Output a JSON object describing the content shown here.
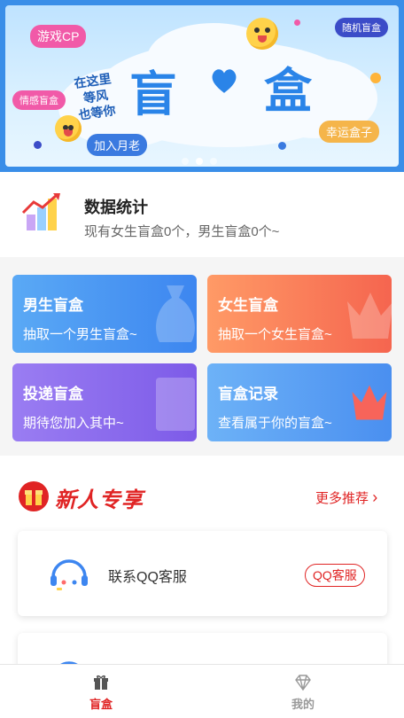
{
  "banner": {
    "title_left": "盲",
    "title_right": "盒",
    "tags": {
      "game_cp": "游戏CP",
      "random_box": "随机盲盒",
      "emotion_box": "情感盲盒",
      "join_moon": "加入月老",
      "lucky_box": "幸运盒子"
    },
    "handwrite_lines": [
      "在这里",
      "等风",
      "也等你"
    ],
    "slide_count": 3,
    "active_slide": 2
  },
  "stats": {
    "title": "数据统计",
    "subtitle": "现有女生盲盒0个，男生盲盒0个~"
  },
  "cards": [
    {
      "title": "男生盲盒",
      "subtitle": "抽取一个男生盲盒~",
      "icon": "money-bag-icon",
      "color_from": "#5aa9f5",
      "color_to": "#3d86f0"
    },
    {
      "title": "女生盲盒",
      "subtitle": "抽取一个女生盲盒~",
      "icon": "crown-icon",
      "color_from": "#ff9a66",
      "color_to": "#f5654f"
    },
    {
      "title": "投递盲盒",
      "subtitle": "期待您加入其中~",
      "icon": "bar-chart-icon",
      "color_from": "#9a7df2",
      "color_to": "#7d5be8"
    },
    {
      "title": "盲盒记录",
      "subtitle": "查看属于你的盲盒~",
      "icon": "crown-icon",
      "color_from": "#6db2f7",
      "color_to": "#4a8ff0"
    }
  ],
  "promo": {
    "title": "新人专享",
    "more": "更多推荐",
    "accent": "#e02424"
  },
  "services": [
    {
      "label": "联系QQ客服",
      "badge": "QQ客服",
      "icon": "headset-icon"
    }
  ],
  "tabbar": {
    "items": [
      {
        "label": "盲盒",
        "icon": "gift-icon",
        "active": true
      },
      {
        "label": "我的",
        "icon": "diamond-icon",
        "active": false
      }
    ],
    "active_color": "#e02424",
    "inactive_color": "#999999"
  }
}
